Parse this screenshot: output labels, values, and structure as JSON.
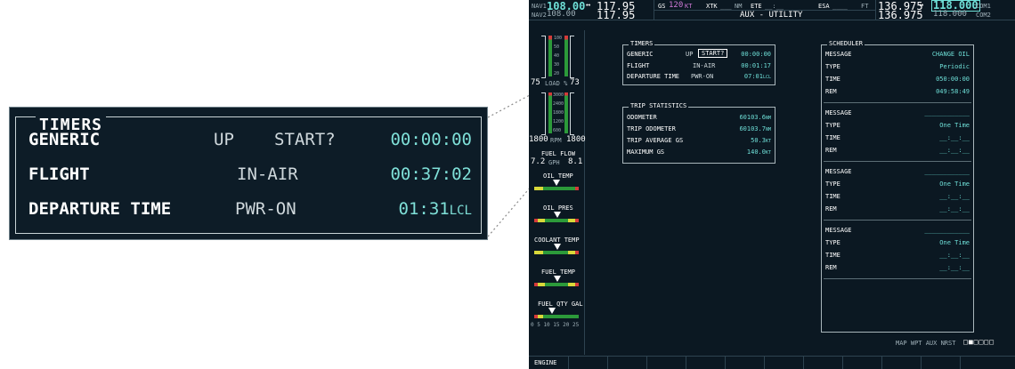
{
  "callout": {
    "title": "TIMERS",
    "rows": [
      {
        "label": "GENERIC",
        "direction": "UP",
        "action": "START?",
        "value": "00:00:00",
        "suffix": ""
      },
      {
        "label": "FLIGHT",
        "mode": "IN-AIR",
        "value": "00:37:02",
        "suffix": ""
      },
      {
        "label": "DEPARTURE TIME",
        "mode": "PWR-ON",
        "value": "01:31",
        "suffix": "LCL"
      }
    ]
  },
  "mfd": {
    "nav": {
      "nav1_label": "NAV1",
      "nav1_active": "108.00",
      "nav1_arrow": "↔",
      "nav1_standby": "117.95",
      "nav2_label": "NAV2",
      "nav2_active": "108.00",
      "nav2_standby": "117.95"
    },
    "fields": {
      "gs_label": "GS",
      "gs_value": "120",
      "gs_unit": "KT",
      "xtk_label": "XTK",
      "xtk_value": "___",
      "xtk_unit": "NM",
      "ete_label": "ETE",
      "ete_value": "__:__",
      "esa_label": "ESA",
      "esa_value": "____",
      "esa_unit": "FT"
    },
    "page_title": "AUX - UTILITY",
    "com": {
      "com1_active": "136.975",
      "com1_arrow": "↔",
      "com1_standby": "118.000",
      "com1_label": "COM1",
      "com2_active": "136.975",
      "com2_standby": "118.000",
      "com2_label": "COM2"
    },
    "gauges": {
      "manifold_ticks": [
        "100",
        "50",
        "40",
        "30",
        "20"
      ],
      "load_left": "75",
      "load_label": "LOAD %",
      "load_right": "73",
      "rpm_ticks": [
        "3000",
        "2400",
        "1800",
        "1200",
        "600"
      ],
      "rpm_left": "1800",
      "rpm_label": "RPM",
      "rpm_right": "1800",
      "fuel_flow_label": "FUEL FLOW",
      "ff_left": "7.2",
      "ff_unit": "GPH",
      "ff_right": "8.1",
      "oil_temp_label": "OIL TEMP",
      "oil_pres_label": "OIL PRES",
      "coolant_temp_label": "COOLANT TEMP",
      "fuel_temp_label": "FUEL TEMP",
      "fuel_qty_label": "FUEL QTY GAL",
      "fuel_qty_scale": "0 5 10 15 20 25"
    },
    "timers": {
      "title": "TIMERS",
      "rows": [
        {
          "label": "GENERIC",
          "direction": "UP",
          "action": "START?",
          "value": "00:00:00"
        },
        {
          "label": "FLIGHT",
          "mode": "IN-AIR",
          "value": "00:01:17"
        },
        {
          "label": "DEPARTURE TIME",
          "mode": "PWR-ON",
          "value": "07:01",
          "suffix": "LCL"
        }
      ]
    },
    "trip": {
      "title": "TRIP STATISTICS",
      "rows": [
        {
          "label": "ODOMETER",
          "value": "60103.6",
          "unit": "NM"
        },
        {
          "label": "TRIP ODOMETER",
          "value": "60103.7",
          "unit": "NM"
        },
        {
          "label": "TRIP AVERAGE GS",
          "value": "50.3",
          "unit": "KT"
        },
        {
          "label": "MAXIMUM GS",
          "value": "140.0",
          "unit": "KT"
        }
      ]
    },
    "scheduler": {
      "title": "SCHEDULER",
      "message_label": "MESSAGE",
      "type_label": "TYPE",
      "time_label": "TIME",
      "rem_label": "REM",
      "entries": [
        {
          "message": "CHANGE OIL",
          "type": "Periodic",
          "time": "050:00:00",
          "rem": "049:58:49"
        },
        {
          "message": "____________",
          "type": "One Time",
          "time": "__:__:__",
          "rem": "__:__:__"
        },
        {
          "message": "____________",
          "type": "One Time",
          "time": "__:__:__",
          "rem": "__:__:__"
        },
        {
          "message": "____________",
          "type": "One Time",
          "time": "__:__:__",
          "rem": "__:__:__"
        }
      ]
    },
    "page_group": {
      "labels": "MAP WPT AUX NRST",
      "indicator": "□■□□□□"
    },
    "softkey_engine": "ENGINE"
  }
}
